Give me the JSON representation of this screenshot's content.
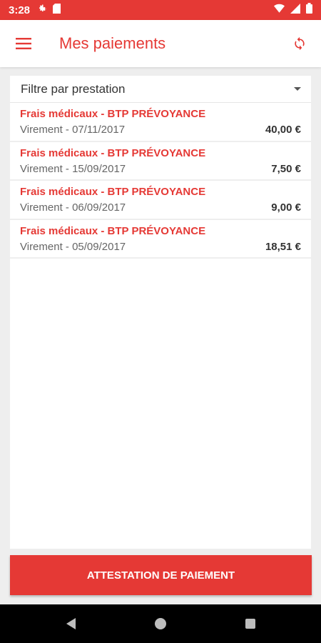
{
  "status_bar": {
    "time": "3:28",
    "icons_left": [
      "gear-icon",
      "sd-card-icon"
    ],
    "icons_right": [
      "wifi-icon",
      "signal-icon",
      "battery-icon"
    ]
  },
  "app_bar": {
    "title": "Mes paiements",
    "menu_icon": "hamburger-menu-icon",
    "refresh_icon": "refresh-icon"
  },
  "filter": {
    "label": "Filtre par prestation",
    "icon": "dropdown-arrow-icon"
  },
  "payments": [
    {
      "title": "Frais médicaux - BTP PRÉVOYANCE",
      "method": "Virement - 07/11/2017",
      "amount": "40,00 €"
    },
    {
      "title": "Frais médicaux - BTP PRÉVOYANCE",
      "method": "Virement - 15/09/2017",
      "amount": "7,50 €"
    },
    {
      "title": "Frais médicaux - BTP PRÉVOYANCE",
      "method": "Virement - 06/09/2017",
      "amount": "9,00 €"
    },
    {
      "title": "Frais médicaux - BTP PRÉVOYANCE",
      "method": "Virement - 05/09/2017",
      "amount": "18,51 €"
    }
  ],
  "cta": {
    "label": "ATTESTATION DE PAIEMENT"
  },
  "nav_bar": {
    "icons": [
      "back-icon",
      "home-icon",
      "recents-icon"
    ]
  },
  "colors": {
    "accent": "#e53935",
    "background": "#eeeeee",
    "nav_bar": "#000000"
  }
}
